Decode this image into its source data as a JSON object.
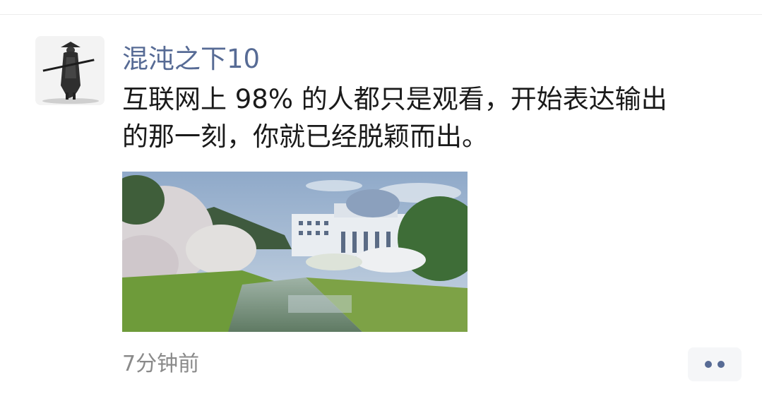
{
  "post": {
    "username": "混沌之下10",
    "content_lines": [
      "互联网上 98% 的人都只是观看，开始表达输出",
      "的那一刻，你就已经脱颖而出。"
    ],
    "timestamp": "7分钟前",
    "avatar_icon": "samurai-silhouette-icon",
    "more_icon": "more-dots-icon",
    "photo_description_icon": "campus-photo"
  },
  "colors": {
    "username": "#576b95",
    "text": "#1a1a1a",
    "timestamp": "#8a8a8a",
    "more_button_bg": "#f5f6f8"
  }
}
